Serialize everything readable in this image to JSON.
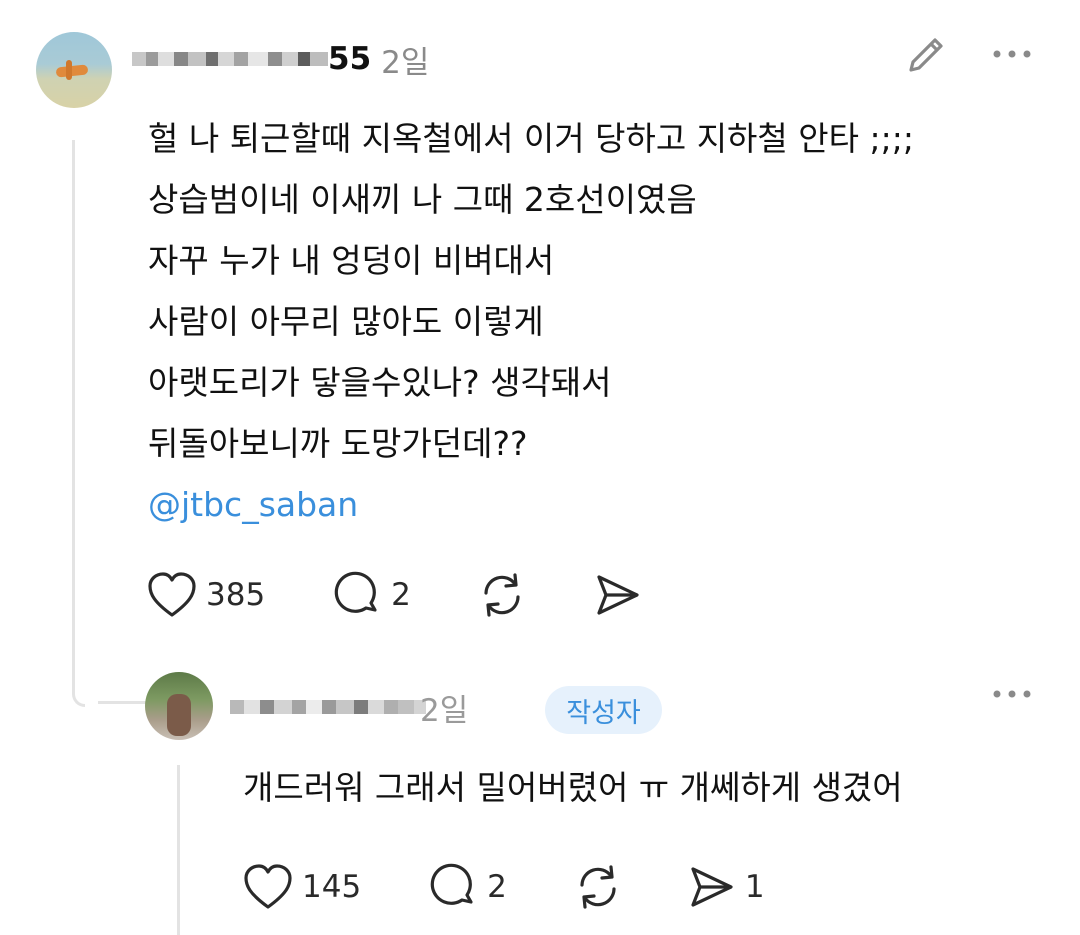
{
  "post": {
    "username_suffix": "55",
    "time": "2일",
    "lines": [
      "헐 나 퇴근할때 지옥철에서 이거 당하고 지하철 안타 ;;;;",
      "상습범이네 이새끼 나 그때 2호선이였음",
      "자꾸 누가 내 엉덩이 비벼대서",
      "사람이 아무리 많아도 이렇게",
      "아랫도리가 닿을수있나? 생각돼서",
      "뒤돌아보니까 도망가던데??"
    ],
    "mention": "@jtbc_saban",
    "likes": "385",
    "replies": "2"
  },
  "reply": {
    "time": "2일",
    "author_badge": "작성자",
    "text": "개드러워 그래서 밀어버렸어 ㅠ 개쎄하게 생겼어",
    "likes": "145",
    "replies": "2",
    "shares": "1"
  },
  "icons": [
    "edit-icon",
    "more-icon",
    "heart-icon",
    "comment-icon",
    "repost-icon",
    "share-icon"
  ]
}
